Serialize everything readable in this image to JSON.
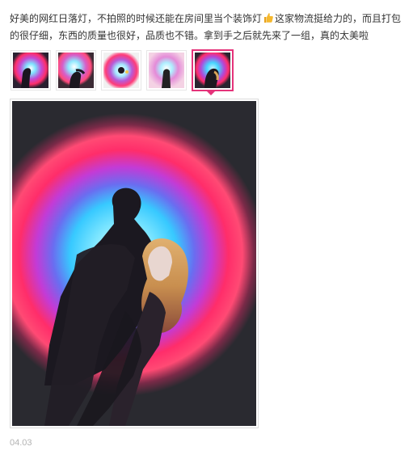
{
  "review": {
    "text_before_emoji": "好美的网红日落灯，不拍照的时候还能在房间里当个装饰灯",
    "emoji": "thumbs-up-icon",
    "text_after_emoji": "这家物流挺给力的，而且打包的很仔细，东西的质量也很好，品质也不错。拿到手之后就先来了一组，真的太美啦"
  },
  "thumbnails": [
    {
      "name": "sunset-lamp-photo-1",
      "selected": false
    },
    {
      "name": "sunset-lamp-photo-2",
      "selected": false
    },
    {
      "name": "sunset-lamp-photo-3",
      "selected": false
    },
    {
      "name": "sunset-lamp-photo-4",
      "selected": false
    },
    {
      "name": "sunset-lamp-photo-5",
      "selected": true
    }
  ],
  "colors": {
    "accent": "#e5337a",
    "halo_outer": "#ff2d6a",
    "halo_inner": "#3fd8ff",
    "text": "#333333",
    "date": "#b3b3b3"
  },
  "date": "04.03"
}
